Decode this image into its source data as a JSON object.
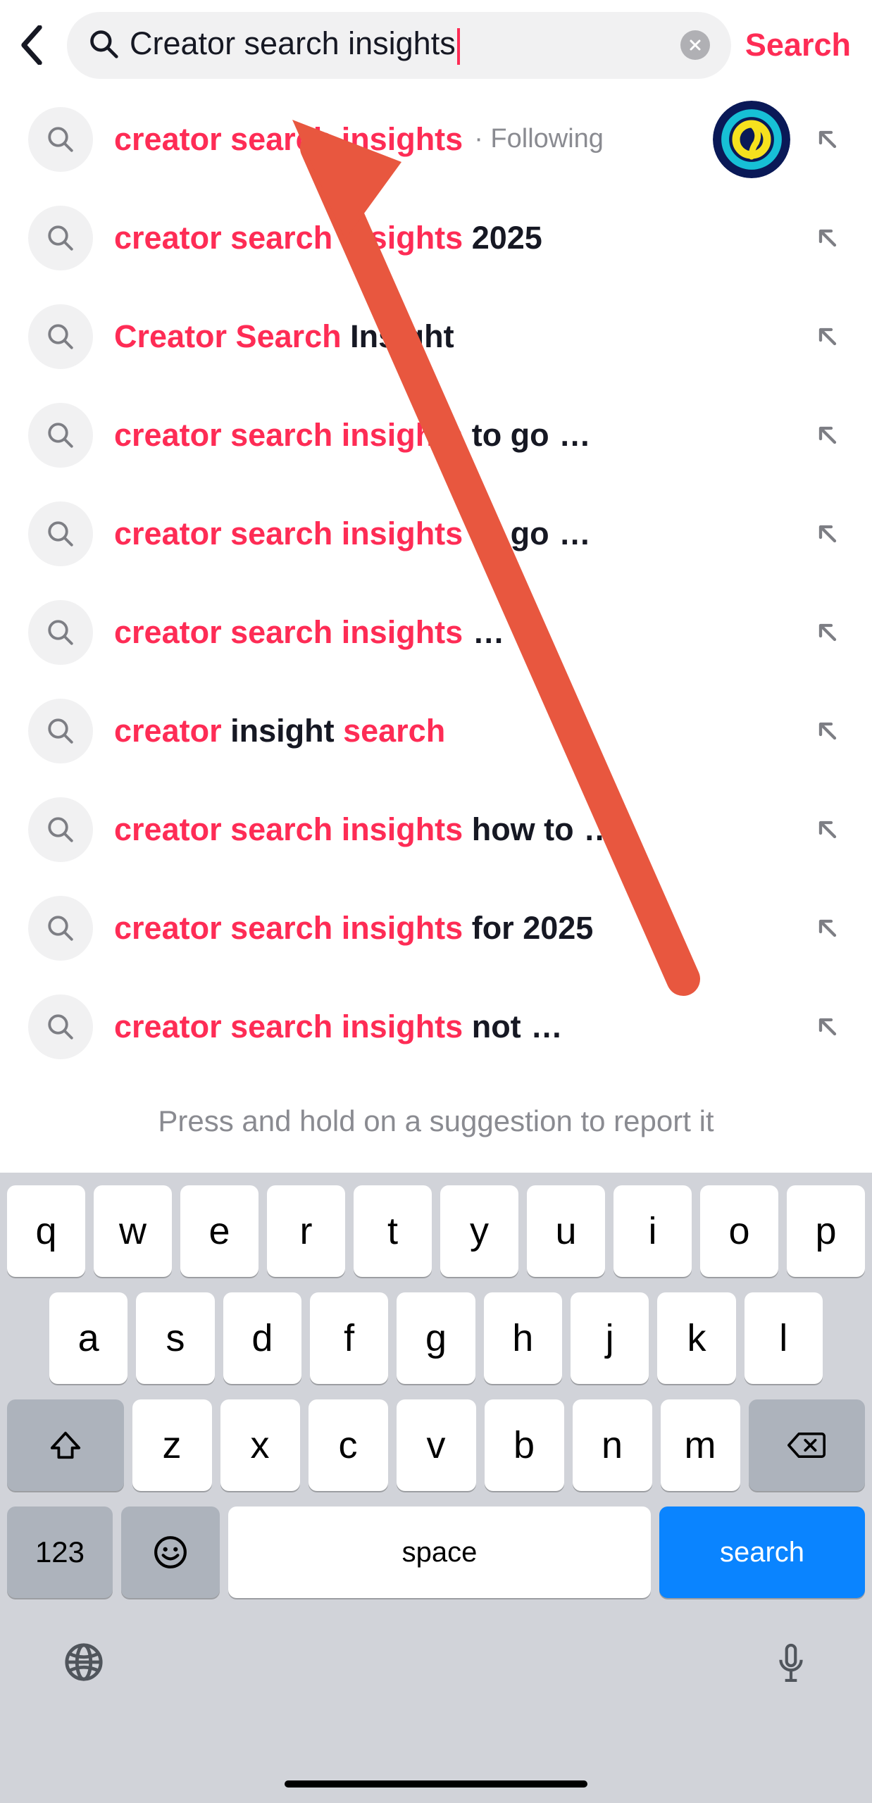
{
  "header": {
    "search_value": "Creator search insights",
    "search_button_label": "Search"
  },
  "suggestions": [
    {
      "parts": [
        {
          "t": "creator search insights",
          "hl": true
        }
      ],
      "following": "· Following",
      "avatar": true
    },
    {
      "parts": [
        {
          "t": "creator search insights",
          "hl": true
        },
        {
          "t": " 2025",
          "hl": false
        }
      ]
    },
    {
      "parts": [
        {
          "t": "Creator Search",
          "hl": true
        },
        {
          "t": " Insight",
          "hl": false
        }
      ]
    },
    {
      "parts": [
        {
          "t": "creator search insights",
          "hl": true
        },
        {
          "t": " to go ",
          "hl": false
        }
      ],
      "ellipsis": true
    },
    {
      "parts": [
        {
          "t": "creator search insights",
          "hl": true
        },
        {
          "t": " to go ",
          "hl": false
        }
      ],
      "ellipsis": true
    },
    {
      "parts": [
        {
          "t": "creator search insights",
          "hl": true
        },
        {
          "t": " ",
          "hl": false
        }
      ],
      "ellipsis": true
    },
    {
      "parts": [
        {
          "t": "creator",
          "hl": true
        },
        {
          "t": " insight ",
          "hl": false
        },
        {
          "t": "search",
          "hl": true
        }
      ]
    },
    {
      "parts": [
        {
          "t": "creator search insights",
          "hl": true
        },
        {
          "t": " how to",
          "hl": false
        }
      ],
      "ellipsis": true
    },
    {
      "parts": [
        {
          "t": "creator search insights",
          "hl": true
        },
        {
          "t": " for 2025",
          "hl": false
        }
      ]
    },
    {
      "parts": [
        {
          "t": "creator search insights",
          "hl": true
        },
        {
          "t": " not ",
          "hl": false
        }
      ],
      "ellipsis": true
    }
  ],
  "report_hint": "Press and hold on a suggestion to report it",
  "keyboard": {
    "row1": [
      "q",
      "w",
      "e",
      "r",
      "t",
      "y",
      "u",
      "i",
      "o",
      "p"
    ],
    "row2": [
      "a",
      "s",
      "d",
      "f",
      "g",
      "h",
      "j",
      "k",
      "l"
    ],
    "row3": [
      "z",
      "x",
      "c",
      "v",
      "b",
      "n",
      "m"
    ],
    "numbers_label": "123",
    "space_label": "space",
    "search_label": "search"
  },
  "colors": {
    "accent": "#fe2c55",
    "key_primary": "#0a84ff"
  }
}
